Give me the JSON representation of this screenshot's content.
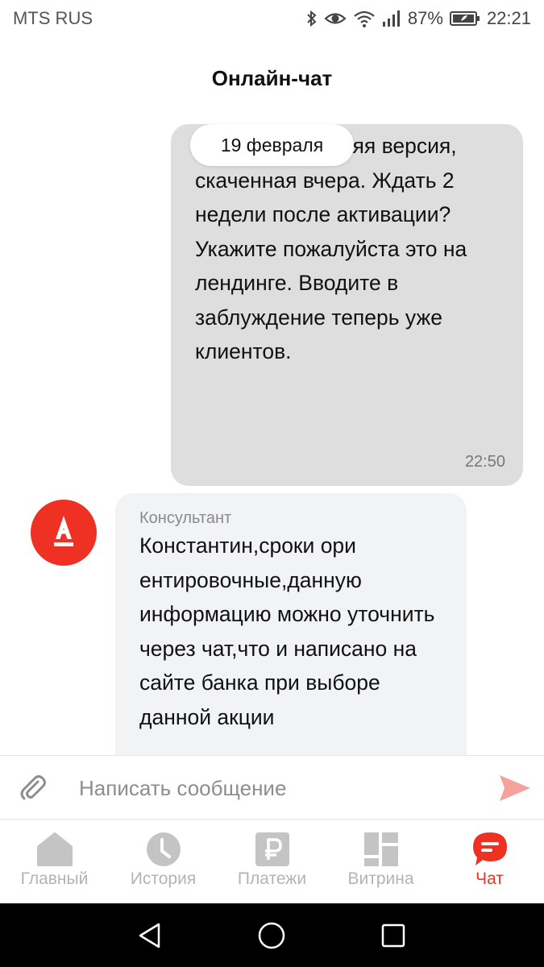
{
  "status_bar": {
    "carrier": "MTS RUS",
    "battery": "87%",
    "time": "22:21",
    "icons": [
      "bluetooth-icon",
      "eye-icon",
      "wifi-icon",
      "signal-icon",
      "battery-icon"
    ]
  },
  "header": {
    "title": "Онлайн-чат"
  },
  "chat": {
    "date_label": "19 февраля",
    "outgoing": {
      "text": "У меня последняя версия, скаченная вчера. Ждать 2 недели после активации? Укажите пожалуйста это на лендинге. Вводите в заблуждение теперь уже клиентов.",
      "time": "22:50"
    },
    "incoming": {
      "sender": "Консультант",
      "text": "Константин,сроки ори ентировочные,данную информацию можно уточнить через чат,что и написано на сайте банка при выборе данной акции"
    }
  },
  "input": {
    "placeholder": "Написать сообщение"
  },
  "nav": {
    "items": [
      {
        "label": "Главный",
        "icon": "home-icon"
      },
      {
        "label": "История",
        "icon": "clock-icon"
      },
      {
        "label": "Платежи",
        "icon": "ruble-icon"
      },
      {
        "label": "Витрина",
        "icon": "showcase-icon"
      },
      {
        "label": "Чат",
        "icon": "chat-icon"
      }
    ],
    "active_index": 4
  },
  "colors": {
    "accent": "#ef3124",
    "outgoing_bubble": "#dedede",
    "incoming_bubble": "#f2f3f5",
    "nav_inactive": "#b3b3b3"
  }
}
